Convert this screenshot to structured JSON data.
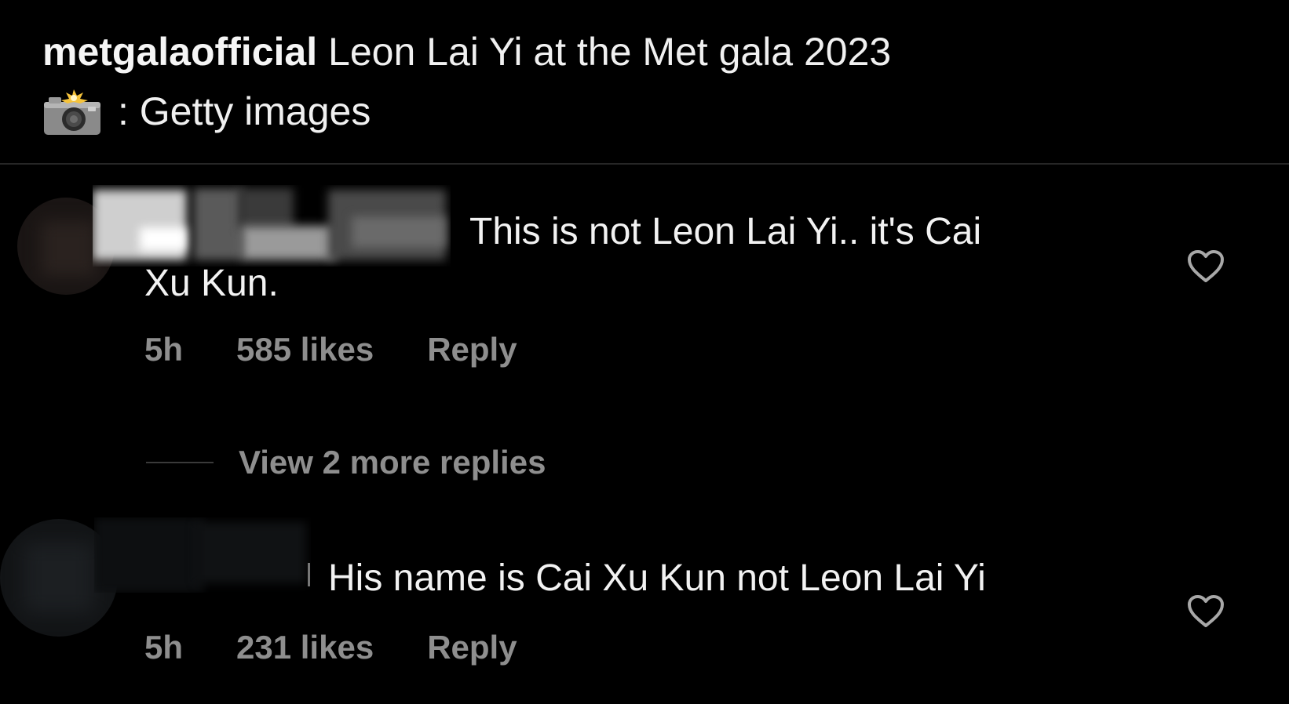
{
  "post": {
    "username": "metgalaofficial",
    "caption": "Leon Lai Yi at the Met gala 2023",
    "credit_icon": "camera-with-flash-icon",
    "credit_text": ": Getty images"
  },
  "comments": [
    {
      "text_line1": "This is not Leon Lai Yi.. it's Cai",
      "text_line2": "Xu Kun.",
      "time": "5h",
      "likes": "585 likes",
      "reply_label": "Reply",
      "like_icon": "heart-icon"
    },
    {
      "text_line1": "His name is Cai Xu Kun not Leon Lai Yi",
      "time": "5h",
      "likes": "231 likes",
      "reply_label": "Reply",
      "like_icon": "heart-icon"
    }
  ],
  "view_replies_label": "View 2 more replies",
  "colors": {
    "background": "#000000",
    "text": "#f2f2f2",
    "secondary_text": "#8e8e8e"
  }
}
